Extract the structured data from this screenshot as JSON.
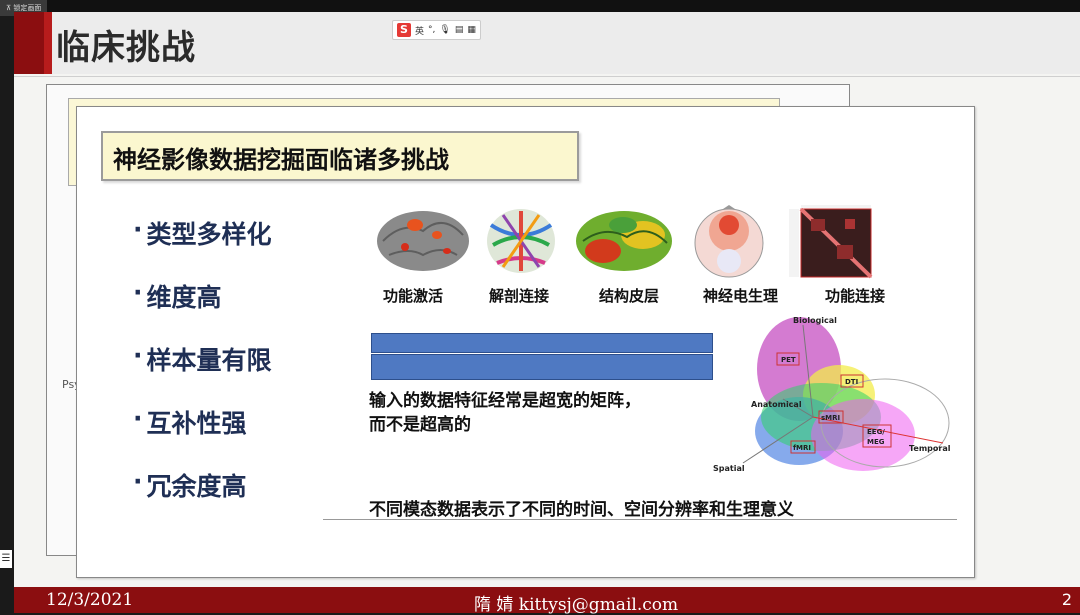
{
  "window": {
    "lock_label": "锁定画面"
  },
  "slide": {
    "title": "临床挑战",
    "subtitle": "神经影像数据挖掘面临诸多挑战",
    "bullets": [
      "类型多样化",
      "维度高",
      "样本量有限",
      "互补性强",
      "冗余度高"
    ],
    "images": [
      {
        "label": "功能激活",
        "icon": "brain-activation-icon"
      },
      {
        "label": "解剖连接",
        "icon": "tractography-icon"
      },
      {
        "label": "结构皮层",
        "icon": "cortex-icon"
      },
      {
        "label": "神经电生理",
        "icon": "eeg-topomap-icon"
      },
      {
        "label": "功能连接",
        "icon": "connectivity-matrix-icon"
      }
    ],
    "note_line1": "输入的数据特征经常是超宽的矩阵，",
    "note_line2": "而不是超高的",
    "caption": "不同模态数据表示了不同的时间、空间分辨率和生理意义",
    "venn": {
      "axis_biological": "Biological",
      "axis_anatomical": "Anatomical",
      "axis_spatial": "Spatial",
      "axis_temporal": "Temporal",
      "pet": "PET",
      "dti": "DTI",
      "smri": "sMRI",
      "fmri": "fMRI",
      "eeg": "EEG/",
      "meg": "MEG"
    },
    "back_fragment": "Psy"
  },
  "ime": {
    "lang": "英"
  },
  "footer": {
    "date": "12/3/2021",
    "author_email": "隋 婧  kittysj@gmail.com",
    "page": "2"
  },
  "colors": {
    "brand_red": "#8b0e10",
    "bullet_blue": "#1f2f55",
    "bar_blue": "#4f79c2",
    "subtitle_bg": "#fbf7cf"
  }
}
